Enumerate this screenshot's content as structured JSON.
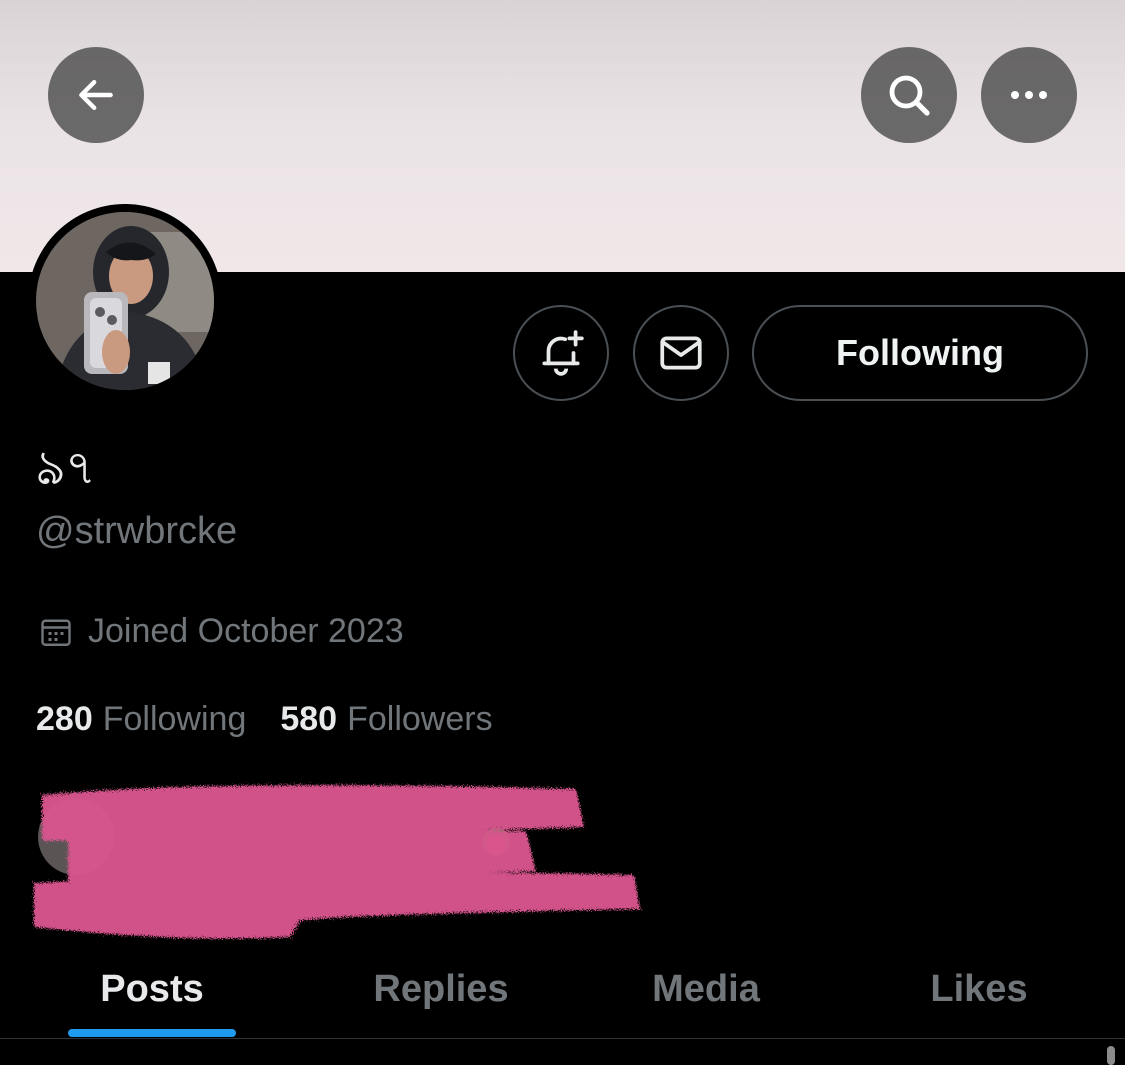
{
  "header": {
    "back_icon": "arrow-left-icon",
    "search_icon": "search-icon",
    "more_icon": "more-horizontal-icon",
    "banner_color": "#ece4e6"
  },
  "profile": {
    "display_name": "ঌ৭",
    "handle": "@strwbrcke",
    "joined": "Joined October 2023",
    "following_count": "280",
    "following_label": "Following",
    "followers_count": "580",
    "followers_label": "Followers",
    "avatar": "profile-photo"
  },
  "actions": {
    "notify_icon": "bell-plus-icon",
    "message_icon": "envelope-icon",
    "following_button": "Following"
  },
  "redaction": {
    "color": "#d9578e"
  },
  "tabs": [
    {
      "label": "Posts",
      "active": true
    },
    {
      "label": "Replies",
      "active": false
    },
    {
      "label": "Media",
      "active": false
    },
    {
      "label": "Likes",
      "active": false
    }
  ],
  "accent_color": "#1d9bf0"
}
